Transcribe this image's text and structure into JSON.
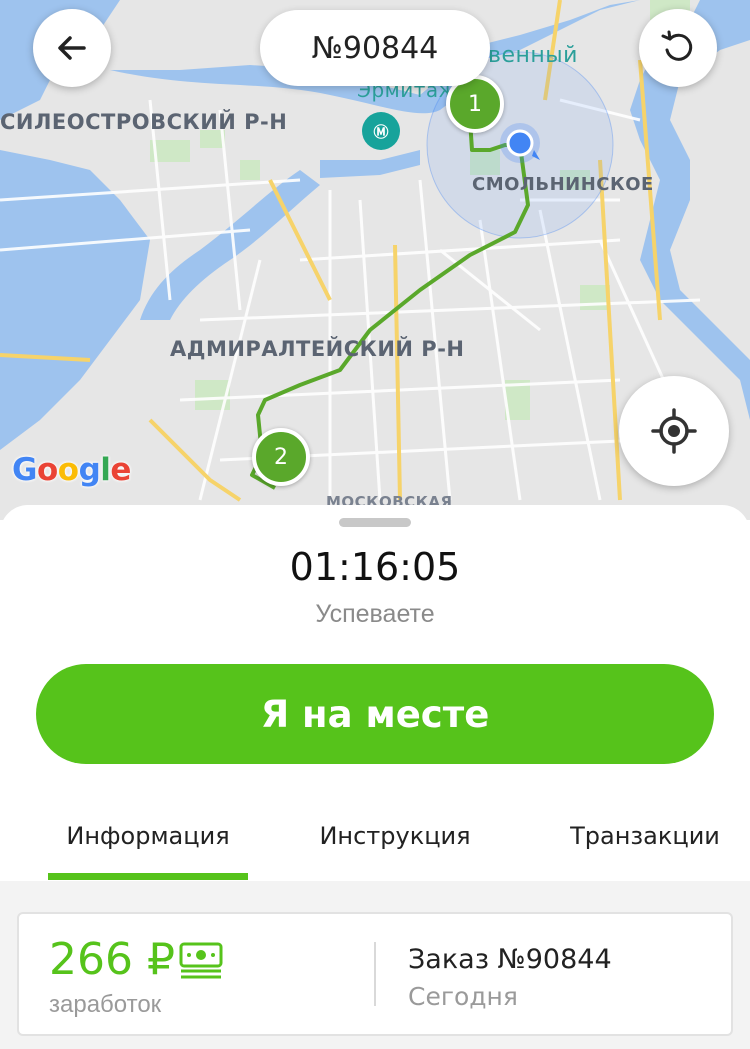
{
  "map": {
    "district_labels": {
      "vasileostrovsky": "СИЛЕОСТРОВСКИЙ Р-Н",
      "admiralteysky": "АДМИРАЛТЕЙСКИЙ Р-Н",
      "smolninskoe": "СМОЛЬНИНСКОЕ",
      "moskovskaya": "МОСКОВСКАЯ"
    },
    "poi_labels": {
      "ermitazh": "Эрмитаж",
      "gosudarstvenny": "венный"
    },
    "museum_icon": "museum-icon",
    "google_logo": [
      "G",
      "o",
      "o",
      "g",
      "l",
      "e"
    ],
    "order_number": "№90844",
    "pins": [
      "1",
      "2"
    ],
    "route_color": "#5aa82b",
    "location_color": "#4285f4"
  },
  "buttons": {
    "back_icon": "arrow-left-icon",
    "refresh_icon": "refresh-icon",
    "locate_icon": "crosshair-icon"
  },
  "sheet": {
    "timer": "01:16:05",
    "status": "Успеваете",
    "arrive_button": "Я на месте",
    "accent_color": "#56c31b",
    "tabs": [
      {
        "label": "Информация",
        "active": true
      },
      {
        "label": "Инструкция",
        "active": false
      },
      {
        "label": "Транзакции",
        "active": false
      }
    ],
    "card": {
      "earnings": "266 ₽",
      "earnings_label": "заработок",
      "cash_icon": "cash-icon",
      "order_title": "Заказ №90844",
      "order_date": "Сегодня"
    }
  }
}
